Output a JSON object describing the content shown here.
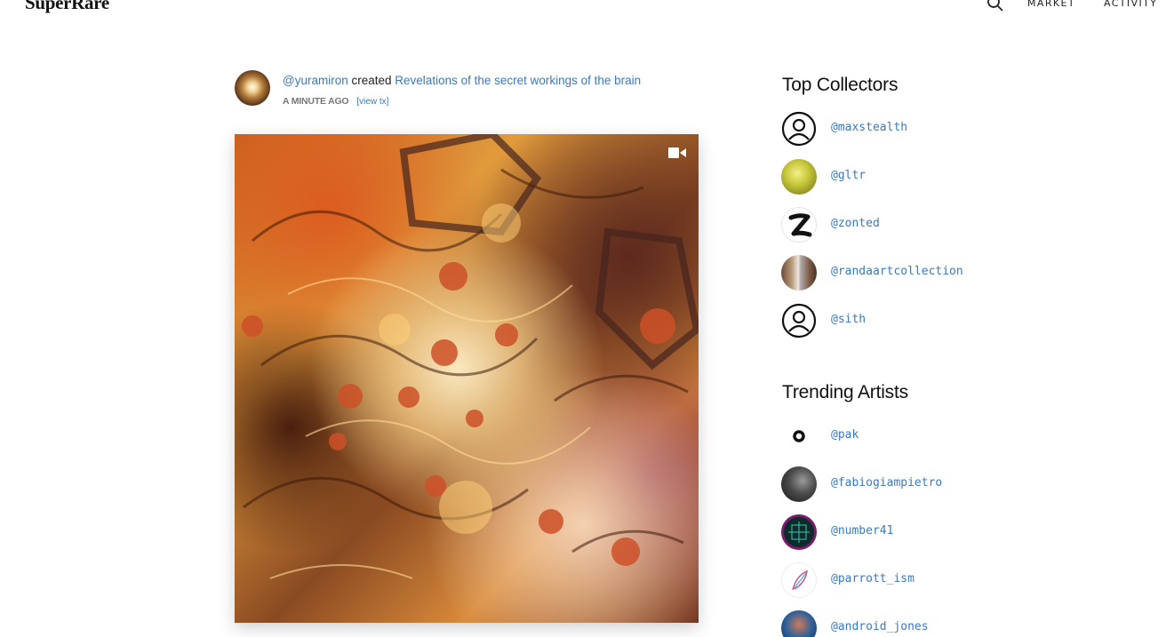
{
  "header": {
    "logo": "SuperRare",
    "nav": [
      "MARKET",
      "ACTIVITY"
    ]
  },
  "feed": {
    "author": "@yuramiron",
    "verb": "created",
    "artwork_title": "Revelations of the secret workings of the brain",
    "time": "A MINUTE AGO",
    "view_tx": "[view tx]"
  },
  "top_collectors": {
    "title": "Top Collectors",
    "users": [
      "@maxstealth",
      "@gltr",
      "@zonted",
      "@randaartcollection",
      "@sith"
    ]
  },
  "trending_artists": {
    "title": "Trending Artists",
    "users": [
      "@pak",
      "@fabiogiampietro",
      "@number41",
      "@parrott_ism",
      "@android_jones"
    ]
  },
  "colors": {
    "link": "#3d78c0",
    "text": "#111111"
  }
}
